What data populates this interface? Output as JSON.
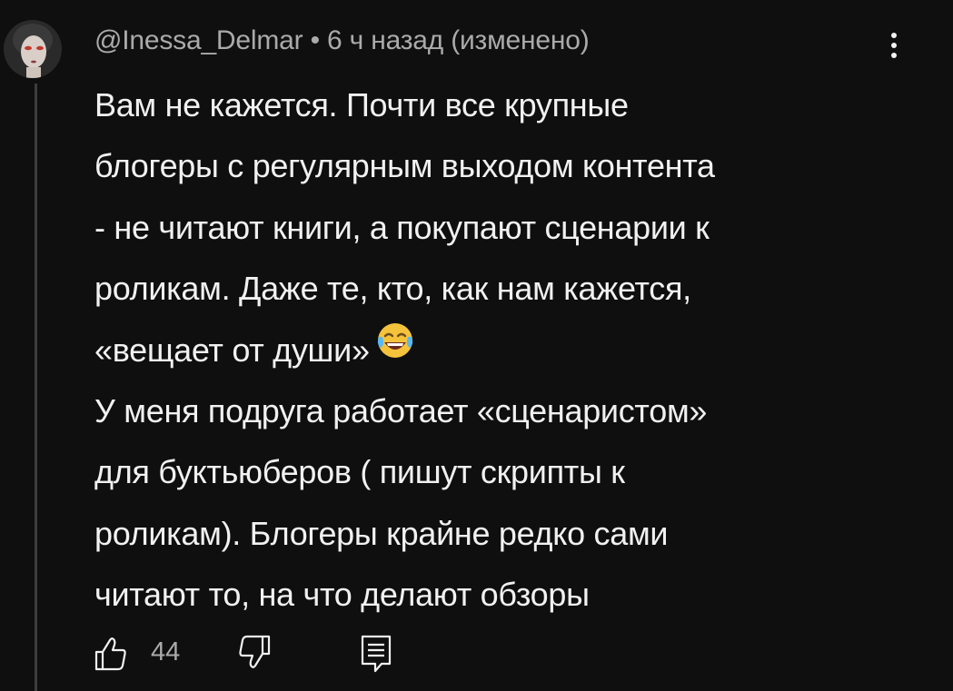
{
  "comment": {
    "author": "@Inessa_Delmar",
    "separator": "•",
    "time": "6 ч назад",
    "edited": "(изменено)",
    "text_lines": [
      "Вам не кажется. Почти все крупные",
      "блогеры с регулярным выходом контента",
      "- не читают книги, а покупают сценарии к",
      "роликам. Даже те, кто, как нам кажется,",
      "«вещает от души»",
      "У меня подруга работает «сценаристом»",
      "для буктьюберов ( пишут скрипты к",
      "роликам). Блогеры крайне редко сами",
      "читают то, на что делают обзоры"
    ],
    "emoji": "face-with-tears-of-joy",
    "like_count": "44"
  },
  "icons": {
    "menu": "kebab-menu-icon",
    "like": "thumbs-up-icon",
    "dislike": "thumbs-down-icon",
    "reply": "reply-icon"
  },
  "colors": {
    "background": "#0f0f0f",
    "text_primary": "#f1f1f1",
    "text_secondary": "#aaaaaa",
    "thread_line": "#3d3d3d"
  }
}
